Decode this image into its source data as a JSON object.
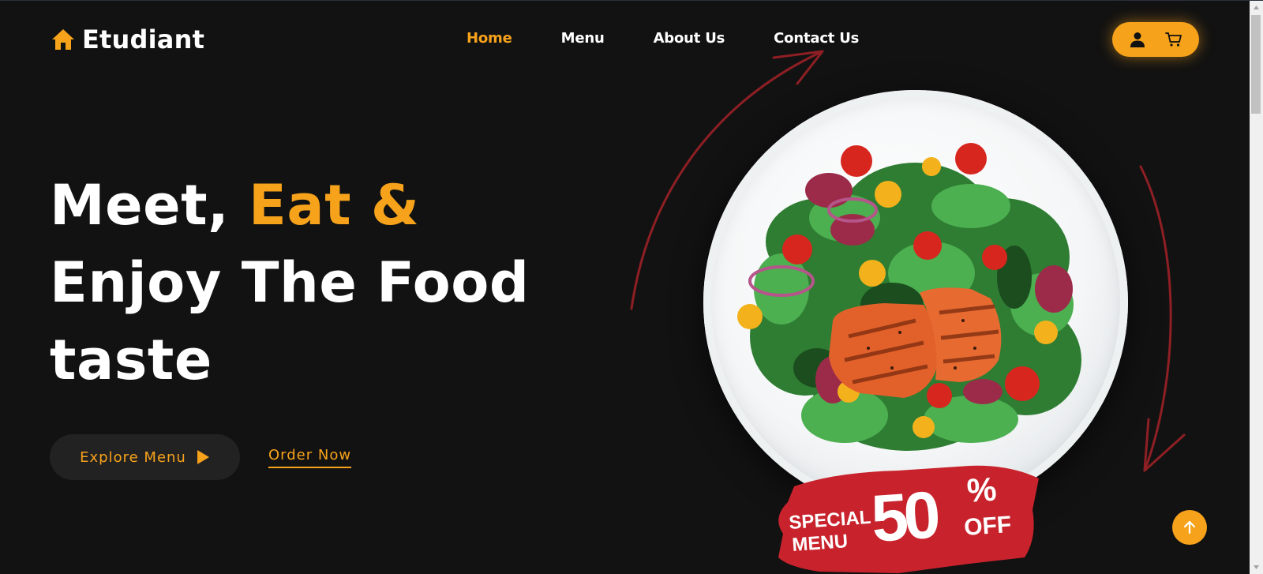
{
  "brand": {
    "name": "Etudiant",
    "icon": "house-icon",
    "accent_color": "#f7a21b"
  },
  "nav": {
    "items": [
      {
        "label": "Home",
        "active": true
      },
      {
        "label": "Menu",
        "active": false
      },
      {
        "label": "About Us",
        "active": false
      },
      {
        "label": "Contact Us",
        "active": false
      }
    ]
  },
  "header_actions": {
    "icons": [
      "user-icon",
      "cart-icon"
    ],
    "color": "#f7a21b"
  },
  "hero": {
    "line1_white": "Meet, ",
    "line1_accent": "Eat &",
    "line2": "Enjoy The Food",
    "line3": "taste",
    "explore_label": "Explore Menu",
    "order_label": "Order Now"
  },
  "promo": {
    "top": "SPECIAL",
    "bottom": "MENU",
    "value": "50",
    "percent": "%",
    "suffix": "OFF",
    "color": "#c8232c"
  },
  "colors": {
    "background": "#121212",
    "accent": "#f7a21b",
    "text": "#ffffff"
  }
}
